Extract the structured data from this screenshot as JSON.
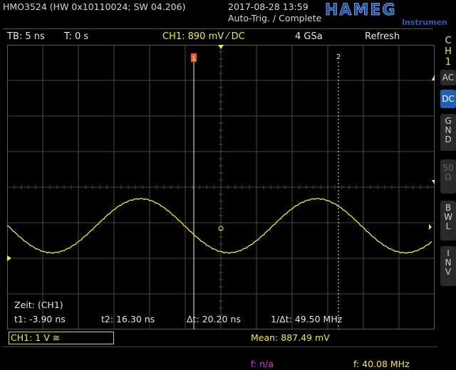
{
  "header": {
    "model": "HMO3524 (HW 0x10110024; SW 04.206)",
    "datetime": "2017-08-28 13:59",
    "status": "Auto-Trig. / Complete",
    "brand": "HAMEG",
    "brand_sub": "Instruments"
  },
  "topbar": {
    "timebase": "TB: 5 ns",
    "trigger_time": "T: 0 s",
    "channel": "CH1: 890 mV ⁄ DC",
    "sample_rate": "4 GSa",
    "mode": "Refresh"
  },
  "sidebar": {
    "channel_label": "C H 1",
    "buttons": [
      {
        "label": "AC",
        "active": false
      },
      {
        "label": "DC",
        "active": true
      },
      {
        "label": "G N D",
        "active": false
      },
      {
        "label": "50 Ω",
        "active": false,
        "dim": true
      },
      {
        "label": "B W L",
        "active": false
      },
      {
        "label": "I N V",
        "active": false
      }
    ]
  },
  "cursors": {
    "cursor1_label": "1",
    "cursor2_label": "2",
    "ch1_marker": "1"
  },
  "measurements": {
    "title": "Zeit: (CH1)",
    "t1": "t1: -3.90 ns",
    "t2": "t2: 16.30 ns",
    "dt": "Δt: 20.20 ns",
    "inv_dt": "1/Δt: 49.50 MHz"
  },
  "footer": {
    "ch1_scale": "CH1: 1 V ≅",
    "mean": "Mean: 887.49 mV",
    "fna": "f: n/a",
    "freq": "f: 40.08 MHz"
  },
  "colors": {
    "trace": "#f2e84a",
    "grid": "#5a5a5a",
    "active_button": "#1f5fb5",
    "cursor1": "#ff6633"
  }
}
